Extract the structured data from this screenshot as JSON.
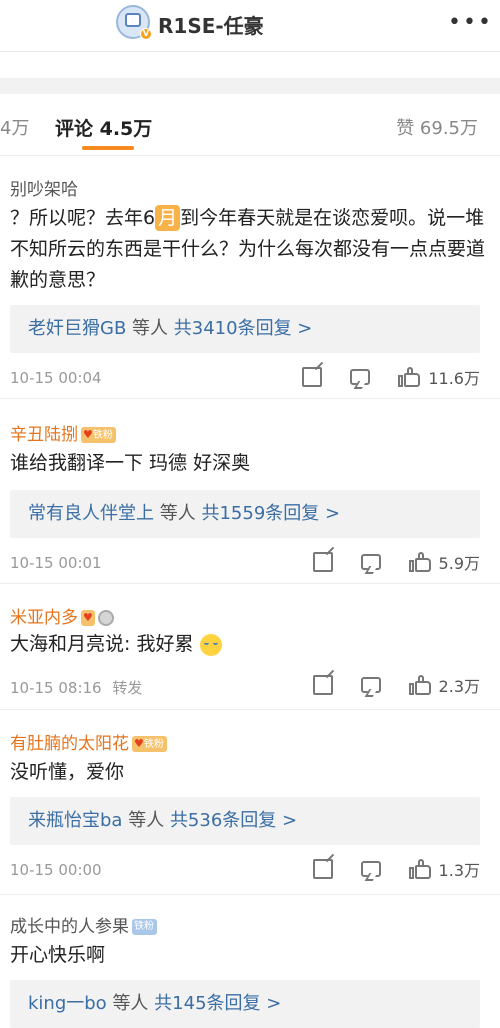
{
  "header": {
    "title": "R1SE-任豪",
    "more_icon": "more-dots-icon"
  },
  "tabs": {
    "left_fragment": "4万",
    "comments": "评论 4.5万",
    "likes": "赞 69.5万",
    "accent": "#f58a1f"
  },
  "comments": [
    {
      "username": "别吵架哈",
      "text_before": "？所以呢？去年6",
      "highlight": "月",
      "text_after": "到今年春天就是在谈恋爱呗。说一堆不知所云的东西是干什么？为什么每次都没有一点点要道歉的意思？",
      "replies_who": "老奸巨猾GB",
      "replies_plain": "等人",
      "replies_count": "共3410条回复 >",
      "time": "10-15 00:04",
      "likes": "11.6万"
    },
    {
      "username": "辛丑陆捌",
      "badge": "铁粉",
      "text": "谁给我翻译一下 玛德 好深奥",
      "replies_who": "常有良人伴堂上",
      "replies_plain": "等人",
      "replies_count": "共1559条回复 >",
      "time": "10-15 00:01",
      "likes": "5.9万"
    },
    {
      "username": "米亚内多",
      "text": "大海和月亮说: 我好累",
      "time": "10-15 08:16",
      "repost": "转发",
      "likes": "2.3万"
    },
    {
      "username": "有肚腩的太阳花",
      "badge": "铁粉",
      "text": "没听懂，爱你",
      "replies_who": "来瓶怡宝ba",
      "replies_plain": "等人",
      "replies_count": "共536条回复 >",
      "time": "10-15 00:00",
      "likes": "1.3万"
    },
    {
      "username": "成长中的人参果",
      "badge": "铁粉",
      "text": "开心快乐啊",
      "replies_who": "king一bo",
      "replies_plain": "等人",
      "replies_count": "共145条回复 >"
    }
  ]
}
